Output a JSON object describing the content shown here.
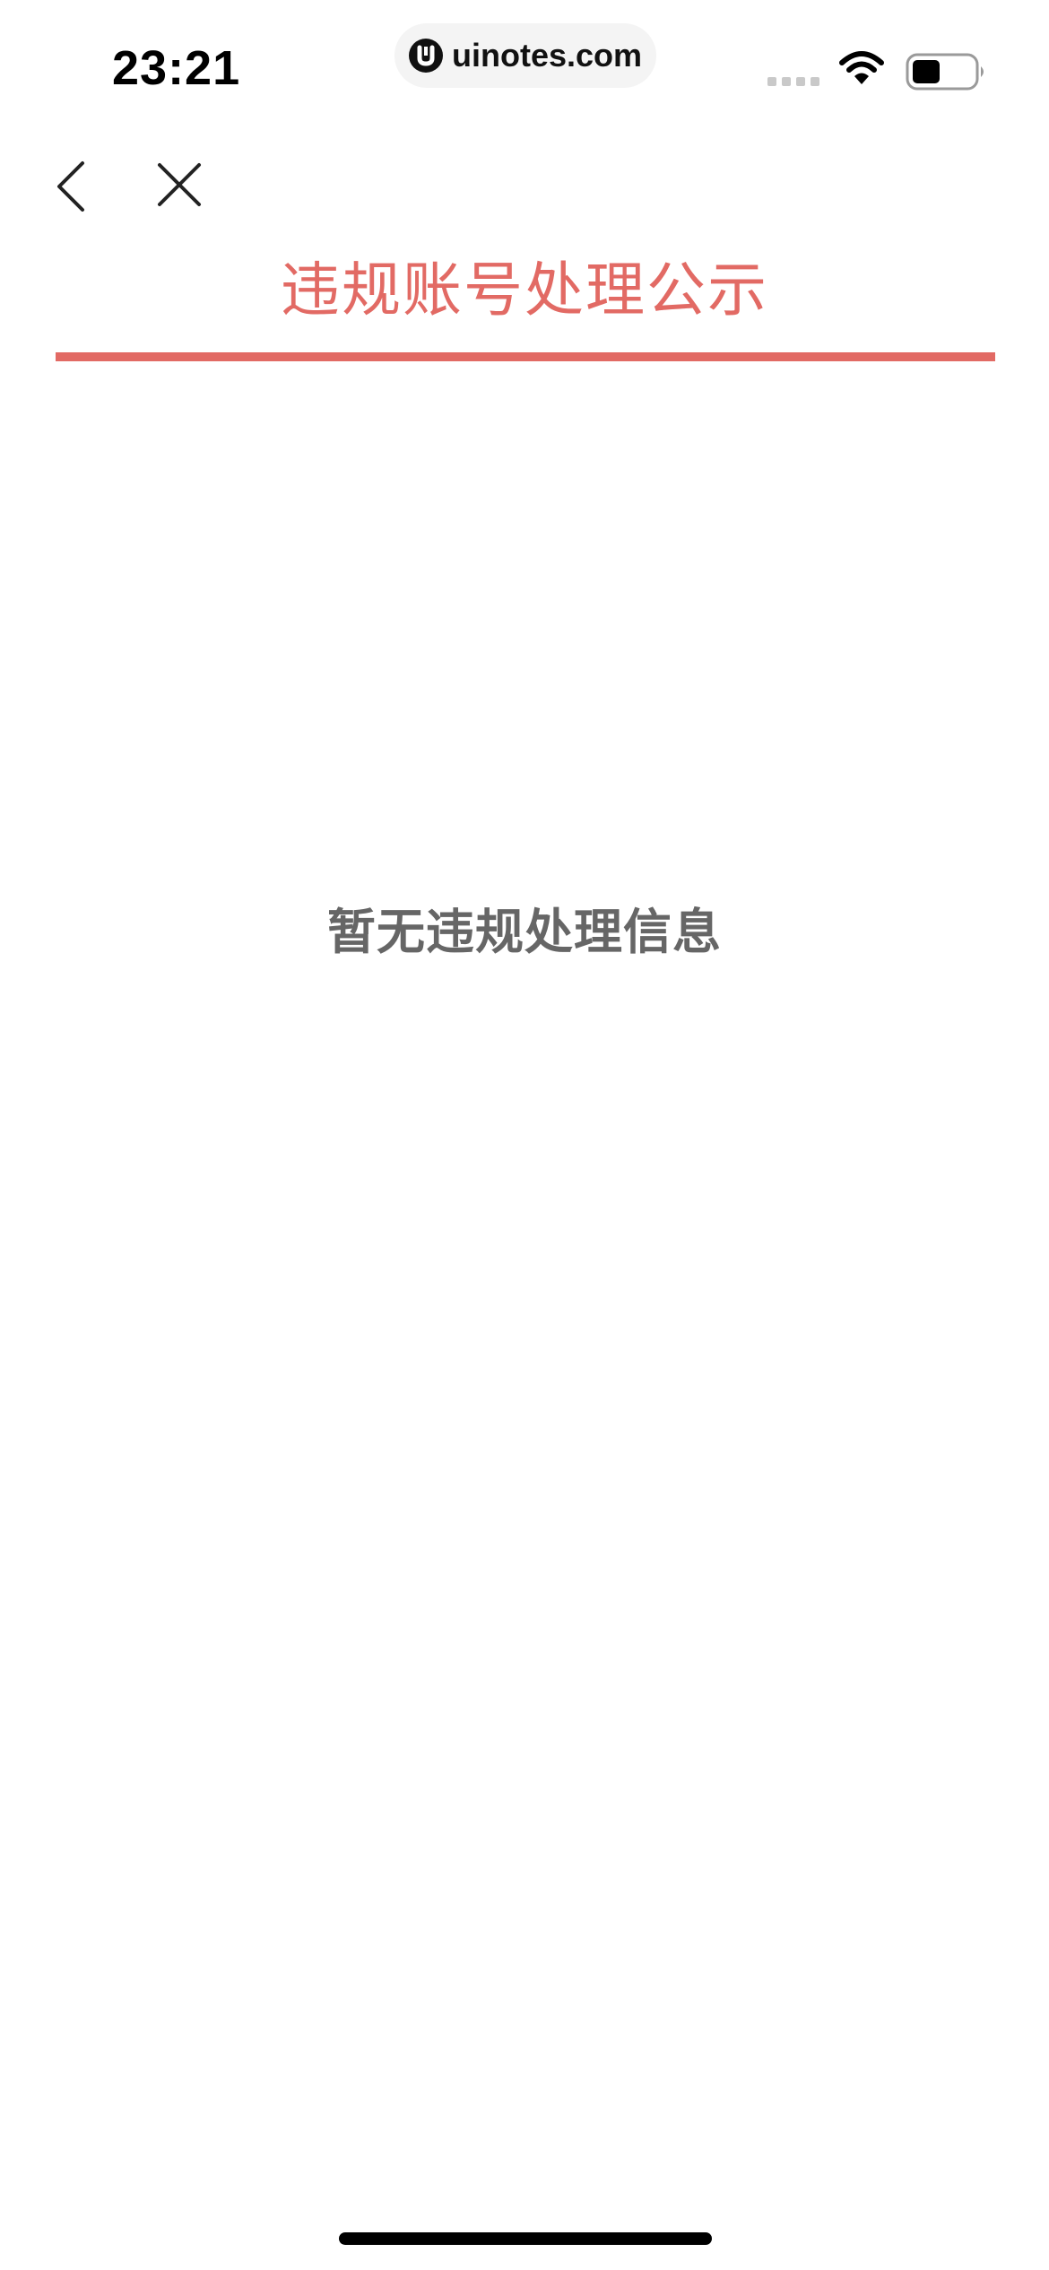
{
  "status_bar": {
    "time": "23:21",
    "url": "uinotes.com",
    "icons": [
      "cellular-signal-icon",
      "wifi-icon",
      "battery-icon"
    ]
  },
  "navigation": {
    "back_icon": "chevron-left-icon",
    "close_icon": "close-icon"
  },
  "page": {
    "title": "违规账号处理公示",
    "empty_message": "暂无违规处理信息"
  },
  "colors": {
    "accent": "#e26a64",
    "empty_text": "#666666"
  }
}
